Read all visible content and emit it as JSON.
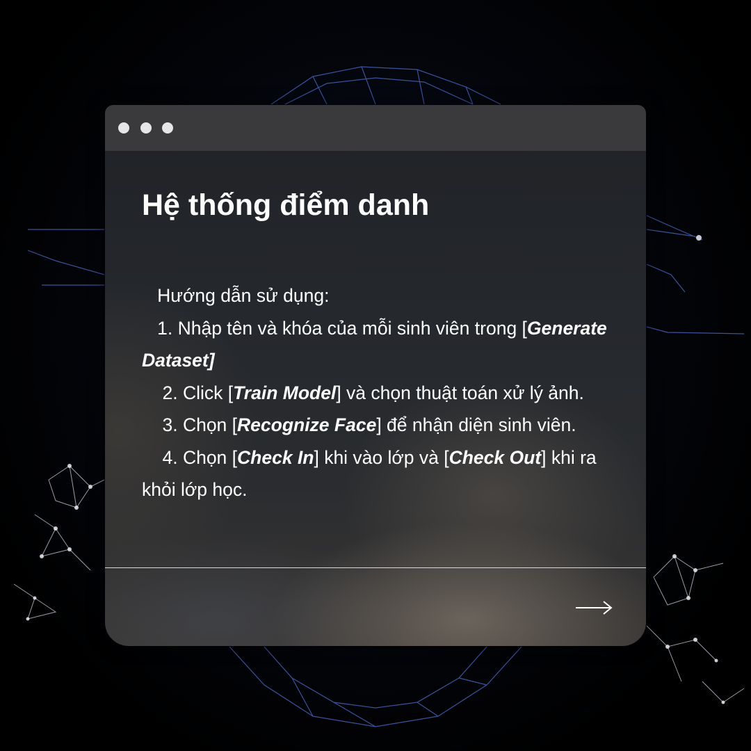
{
  "window": {
    "controls": [
      "window-dot",
      "window-dot",
      "window-dot"
    ]
  },
  "card": {
    "title": "Hệ thống điểm danh",
    "intro": "Hướng dẫn sử dụng:",
    "steps": [
      {
        "number": "1.",
        "before": "Nhập tên và khóa của mỗi sinh viên trong [",
        "emph1": "Generate Dataset]",
        "middle": "",
        "emph2": "",
        "after": ""
      },
      {
        "number": "2.",
        "before": "Click [",
        "emph1": "Train  Model",
        "middle": "] và chọn thuật toán xử lý ảnh.",
        "emph2": "",
        "after": ""
      },
      {
        "number": "3.",
        "before": "Chọn [",
        "emph1": "Recognize Face",
        "middle": "] để nhận diện sinh viên.",
        "emph2": "",
        "after": ""
      },
      {
        "number": "4.",
        "before": "Chọn [",
        "emph1": "Check In",
        "middle": "] khi vào lớp và [",
        "emph2": "Check Out",
        "after": "] khi ra khỏi lớp học."
      }
    ]
  },
  "footer": {
    "next_icon": "arrow-right-icon"
  },
  "colors": {
    "titlebar": "#3a3a3c",
    "dot": "#e6e6e6",
    "text": "#ffffff",
    "divider": "#d9d9d9",
    "network_lines": "#3b5bb0"
  }
}
